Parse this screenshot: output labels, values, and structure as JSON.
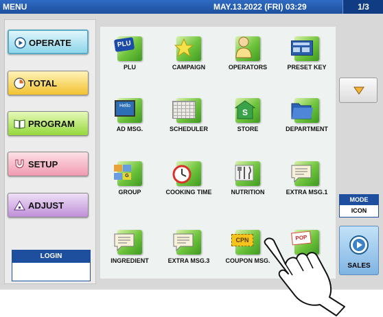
{
  "topbar": {
    "menu_label": "MENU",
    "datetime": "MAY.13.2022 (FRI)  03:29",
    "page": "1/3"
  },
  "categories": [
    {
      "label": "OPERATE",
      "icon": "play-circle-icon"
    },
    {
      "label": "TOTAL",
      "icon": "clock-icon"
    },
    {
      "label": "PROGRAM",
      "icon": "book-icon"
    },
    {
      "label": "SETUP",
      "icon": "wrench-icon"
    },
    {
      "label": "ADJUST",
      "icon": "scale-icon"
    }
  ],
  "login": {
    "label": "LOGIN",
    "value": ""
  },
  "menu_items": [
    {
      "label": "PLU",
      "icon_text": "PLU"
    },
    {
      "label": "CAMPAIGN",
      "icon_text": ""
    },
    {
      "label": "OPERATORS",
      "icon_text": ""
    },
    {
      "label": "PRESET KEY",
      "icon_text": ""
    },
    {
      "label": "AD MSG.",
      "icon_text": "Hello"
    },
    {
      "label": "SCHEDULER",
      "icon_text": ""
    },
    {
      "label": "STORE",
      "icon_text": "S"
    },
    {
      "label": "DEPARTMENT",
      "icon_text": ""
    },
    {
      "label": "GROUP",
      "icon_text": "G"
    },
    {
      "label": "COOKING TIME",
      "icon_text": ""
    },
    {
      "label": "NUTRITION",
      "icon_text": ""
    },
    {
      "label": "EXTRA MSG.1",
      "icon_text": ""
    },
    {
      "label": "INGREDIENT",
      "icon_text": ""
    },
    {
      "label": "EXTRA MSG.3",
      "icon_text": ""
    },
    {
      "label": "COUPON MSG.",
      "icon_text": "CPN"
    },
    {
      "label": "",
      "icon_text": "POP"
    }
  ],
  "mode": {
    "label": "MODE",
    "value": "ICON"
  },
  "sales": {
    "label": "SALES"
  },
  "colors": {
    "header": "#1d4f9e",
    "icon_green": "#6cc23a",
    "grid_bg": "#eef2f0"
  }
}
